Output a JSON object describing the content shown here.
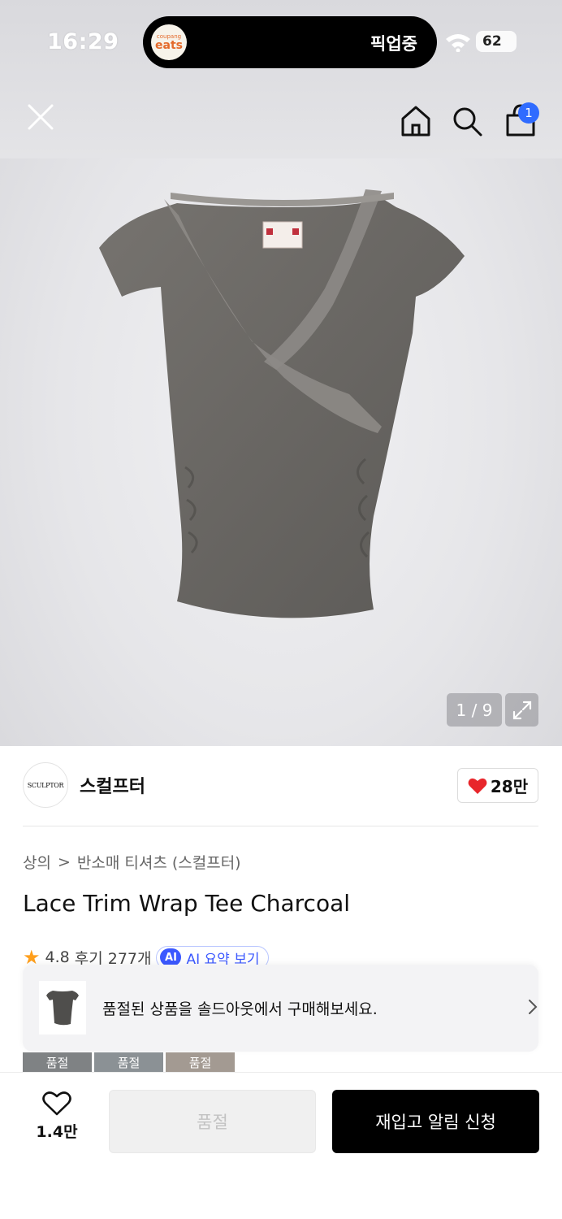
{
  "status_bar": {
    "time": "16:29",
    "activity_badge_small": "coupang",
    "activity_badge_big": "eats",
    "activity_text": "픽업중",
    "battery": "62"
  },
  "nav": {
    "cart_count": "1"
  },
  "gallery": {
    "counter": "1 / 9"
  },
  "brand": {
    "logo_text": "SCULPTOR",
    "name": "스컬프터",
    "likes": "28만"
  },
  "breadcrumb": {
    "category": "상의",
    "separator": ">",
    "subcategory": "반소매 티셔츠 (스컬프터)"
  },
  "product": {
    "title": "Lace Trim Wrap Tee Charcoal",
    "rating": "4.8",
    "review_label": "후기 277개",
    "ai_label": "AI",
    "ai_summary": "AI 요약 보기"
  },
  "soldout_banner": {
    "text": "품절된 상품을 솔드아웃에서 구매해보세요."
  },
  "option_thumbs": [
    "품절",
    "품절",
    "품절"
  ],
  "bottom": {
    "wish_count": "1.4만",
    "soldout_label": "품절",
    "restock_label": "재입고 알림 신청"
  },
  "colors": {
    "accent_blue": "#2f6bff",
    "heart_red": "#e8262b",
    "star_orange": "#ff9f1c",
    "primary_black": "#000000"
  }
}
